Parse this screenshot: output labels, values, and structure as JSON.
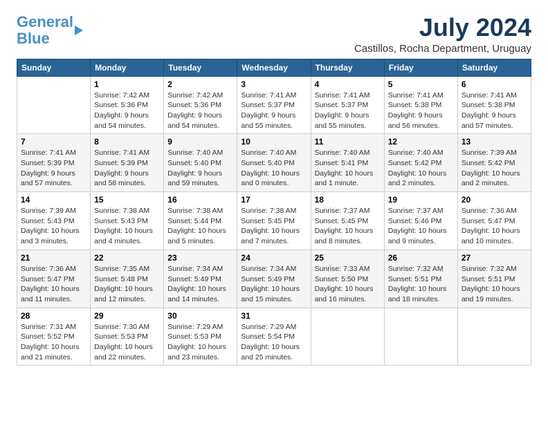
{
  "logo": {
    "line1": "General",
    "line2": "Blue"
  },
  "title": {
    "month_year": "July 2024",
    "location": "Castillos, Rocha Department, Uruguay"
  },
  "days_of_week": [
    "Sunday",
    "Monday",
    "Tuesday",
    "Wednesday",
    "Thursday",
    "Friday",
    "Saturday"
  ],
  "weeks": [
    [
      {
        "day": "",
        "sunrise": "",
        "sunset": "",
        "daylight": ""
      },
      {
        "day": "1",
        "sunrise": "Sunrise: 7:42 AM",
        "sunset": "Sunset: 5:36 PM",
        "daylight": "Daylight: 9 hours and 54 minutes."
      },
      {
        "day": "2",
        "sunrise": "Sunrise: 7:42 AM",
        "sunset": "Sunset: 5:36 PM",
        "daylight": "Daylight: 9 hours and 54 minutes."
      },
      {
        "day": "3",
        "sunrise": "Sunrise: 7:41 AM",
        "sunset": "Sunset: 5:37 PM",
        "daylight": "Daylight: 9 hours and 55 minutes."
      },
      {
        "day": "4",
        "sunrise": "Sunrise: 7:41 AM",
        "sunset": "Sunset: 5:37 PM",
        "daylight": "Daylight: 9 hours and 55 minutes."
      },
      {
        "day": "5",
        "sunrise": "Sunrise: 7:41 AM",
        "sunset": "Sunset: 5:38 PM",
        "daylight": "Daylight: 9 hours and 56 minutes."
      },
      {
        "day": "6",
        "sunrise": "Sunrise: 7:41 AM",
        "sunset": "Sunset: 5:38 PM",
        "daylight": "Daylight: 9 hours and 57 minutes."
      }
    ],
    [
      {
        "day": "7",
        "sunrise": "Sunrise: 7:41 AM",
        "sunset": "Sunset: 5:39 PM",
        "daylight": "Daylight: 9 hours and 57 minutes."
      },
      {
        "day": "8",
        "sunrise": "Sunrise: 7:41 AM",
        "sunset": "Sunset: 5:39 PM",
        "daylight": "Daylight: 9 hours and 58 minutes."
      },
      {
        "day": "9",
        "sunrise": "Sunrise: 7:40 AM",
        "sunset": "Sunset: 5:40 PM",
        "daylight": "Daylight: 9 hours and 59 minutes."
      },
      {
        "day": "10",
        "sunrise": "Sunrise: 7:40 AM",
        "sunset": "Sunset: 5:40 PM",
        "daylight": "Daylight: 10 hours and 0 minutes."
      },
      {
        "day": "11",
        "sunrise": "Sunrise: 7:40 AM",
        "sunset": "Sunset: 5:41 PM",
        "daylight": "Daylight: 10 hours and 1 minute."
      },
      {
        "day": "12",
        "sunrise": "Sunrise: 7:40 AM",
        "sunset": "Sunset: 5:42 PM",
        "daylight": "Daylight: 10 hours and 2 minutes."
      },
      {
        "day": "13",
        "sunrise": "Sunrise: 7:39 AM",
        "sunset": "Sunset: 5:42 PM",
        "daylight": "Daylight: 10 hours and 2 minutes."
      }
    ],
    [
      {
        "day": "14",
        "sunrise": "Sunrise: 7:39 AM",
        "sunset": "Sunset: 5:43 PM",
        "daylight": "Daylight: 10 hours and 3 minutes."
      },
      {
        "day": "15",
        "sunrise": "Sunrise: 7:38 AM",
        "sunset": "Sunset: 5:43 PM",
        "daylight": "Daylight: 10 hours and 4 minutes."
      },
      {
        "day": "16",
        "sunrise": "Sunrise: 7:38 AM",
        "sunset": "Sunset: 5:44 PM",
        "daylight": "Daylight: 10 hours and 5 minutes."
      },
      {
        "day": "17",
        "sunrise": "Sunrise: 7:38 AM",
        "sunset": "Sunset: 5:45 PM",
        "daylight": "Daylight: 10 hours and 7 minutes."
      },
      {
        "day": "18",
        "sunrise": "Sunrise: 7:37 AM",
        "sunset": "Sunset: 5:45 PM",
        "daylight": "Daylight: 10 hours and 8 minutes."
      },
      {
        "day": "19",
        "sunrise": "Sunrise: 7:37 AM",
        "sunset": "Sunset: 5:46 PM",
        "daylight": "Daylight: 10 hours and 9 minutes."
      },
      {
        "day": "20",
        "sunrise": "Sunrise: 7:36 AM",
        "sunset": "Sunset: 5:47 PM",
        "daylight": "Daylight: 10 hours and 10 minutes."
      }
    ],
    [
      {
        "day": "21",
        "sunrise": "Sunrise: 7:36 AM",
        "sunset": "Sunset: 5:47 PM",
        "daylight": "Daylight: 10 hours and 11 minutes."
      },
      {
        "day": "22",
        "sunrise": "Sunrise: 7:35 AM",
        "sunset": "Sunset: 5:48 PM",
        "daylight": "Daylight: 10 hours and 12 minutes."
      },
      {
        "day": "23",
        "sunrise": "Sunrise: 7:34 AM",
        "sunset": "Sunset: 5:49 PM",
        "daylight": "Daylight: 10 hours and 14 minutes."
      },
      {
        "day": "24",
        "sunrise": "Sunrise: 7:34 AM",
        "sunset": "Sunset: 5:49 PM",
        "daylight": "Daylight: 10 hours and 15 minutes."
      },
      {
        "day": "25",
        "sunrise": "Sunrise: 7:33 AM",
        "sunset": "Sunset: 5:50 PM",
        "daylight": "Daylight: 10 hours and 16 minutes."
      },
      {
        "day": "26",
        "sunrise": "Sunrise: 7:32 AM",
        "sunset": "Sunset: 5:51 PM",
        "daylight": "Daylight: 10 hours and 18 minutes."
      },
      {
        "day": "27",
        "sunrise": "Sunrise: 7:32 AM",
        "sunset": "Sunset: 5:51 PM",
        "daylight": "Daylight: 10 hours and 19 minutes."
      }
    ],
    [
      {
        "day": "28",
        "sunrise": "Sunrise: 7:31 AM",
        "sunset": "Sunset: 5:52 PM",
        "daylight": "Daylight: 10 hours and 21 minutes."
      },
      {
        "day": "29",
        "sunrise": "Sunrise: 7:30 AM",
        "sunset": "Sunset: 5:53 PM",
        "daylight": "Daylight: 10 hours and 22 minutes."
      },
      {
        "day": "30",
        "sunrise": "Sunrise: 7:29 AM",
        "sunset": "Sunset: 5:53 PM",
        "daylight": "Daylight: 10 hours and 23 minutes."
      },
      {
        "day": "31",
        "sunrise": "Sunrise: 7:29 AM",
        "sunset": "Sunset: 5:54 PM",
        "daylight": "Daylight: 10 hours and 25 minutes."
      },
      {
        "day": "",
        "sunrise": "",
        "sunset": "",
        "daylight": ""
      },
      {
        "day": "",
        "sunrise": "",
        "sunset": "",
        "daylight": ""
      },
      {
        "day": "",
        "sunrise": "",
        "sunset": "",
        "daylight": ""
      }
    ]
  ]
}
